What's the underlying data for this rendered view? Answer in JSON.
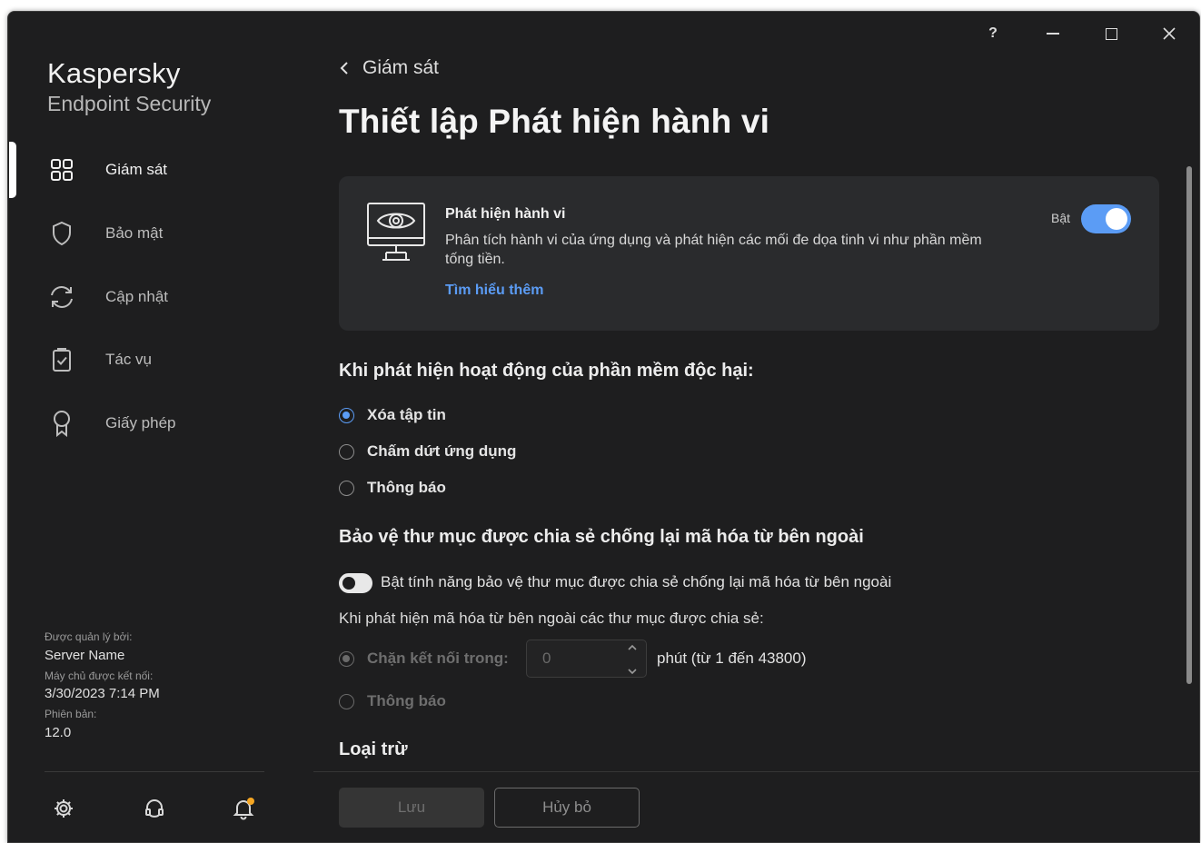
{
  "window": {
    "help_label": "?",
    "controls": [
      "minimize",
      "maximize",
      "close"
    ]
  },
  "sidebar": {
    "brand_name": "Kaspersky",
    "brand_product": "Endpoint Security",
    "items": [
      {
        "label": "Giám sát",
        "icon": "dashboard-grid-icon",
        "active": true
      },
      {
        "label": "Bảo mật",
        "icon": "shield-icon",
        "active": false
      },
      {
        "label": "Cập nhật",
        "icon": "refresh-icon",
        "active": false
      },
      {
        "label": "Tác vụ",
        "icon": "task-clipboard-icon",
        "active": false
      },
      {
        "label": "Giấy phép",
        "icon": "license-ribbon-icon",
        "active": false
      }
    ],
    "managed_by_label": "Được quản lý bởi:",
    "managed_by_value": "Server Name",
    "server_connected_label": "Máy chủ được kết nối:",
    "server_connected_value": "3/30/2023 7:14 PM",
    "version_label": "Phiên bản:",
    "version_value": "12.0",
    "footer_icons": [
      "gear-icon",
      "support-icon",
      "bell-icon"
    ]
  },
  "main": {
    "breadcrumb": "Giám sát",
    "title": "Thiết lập Phát hiện hành vi",
    "card": {
      "title": "Phát hiện hành vi",
      "description": "Phân tích hành vi của ứng dụng và phát hiện các mối đe dọa tinh vi như phần mềm tống tiền.",
      "link": "Tìm hiểu thêm",
      "toggle_label": "Bật",
      "toggle_on": true
    },
    "malware_section": {
      "heading": "Khi phát hiện hoạt động của phần mềm độc hại:",
      "options": [
        "Xóa tập tin",
        "Chấm dứt ứng dụng",
        "Thông báo"
      ],
      "selected": "Xóa tập tin"
    },
    "shared_folder_section": {
      "heading": "Bảo vệ thư mục được chia sẻ chống lại mã hóa từ bên ngoài",
      "toggle_label": "Bật tính năng bảo vệ thư mục được chia sẻ chống lại mã hóa từ bên ngoài",
      "toggle_on": false,
      "subheading": "Khi phát hiện mã hóa từ bên ngoài các thư mục được chia sẻ:",
      "block_label": "Chặn kết nối trong:",
      "block_value": "0",
      "block_unit": "phút (từ 1 đến 43800)",
      "notify_label": "Thông báo",
      "selected": "Chặn kết nối trong:",
      "disabled": true
    },
    "exclusions_heading": "Loại trừ",
    "buttons": {
      "save": "Lưu",
      "cancel": "Hủy bỏ"
    }
  }
}
